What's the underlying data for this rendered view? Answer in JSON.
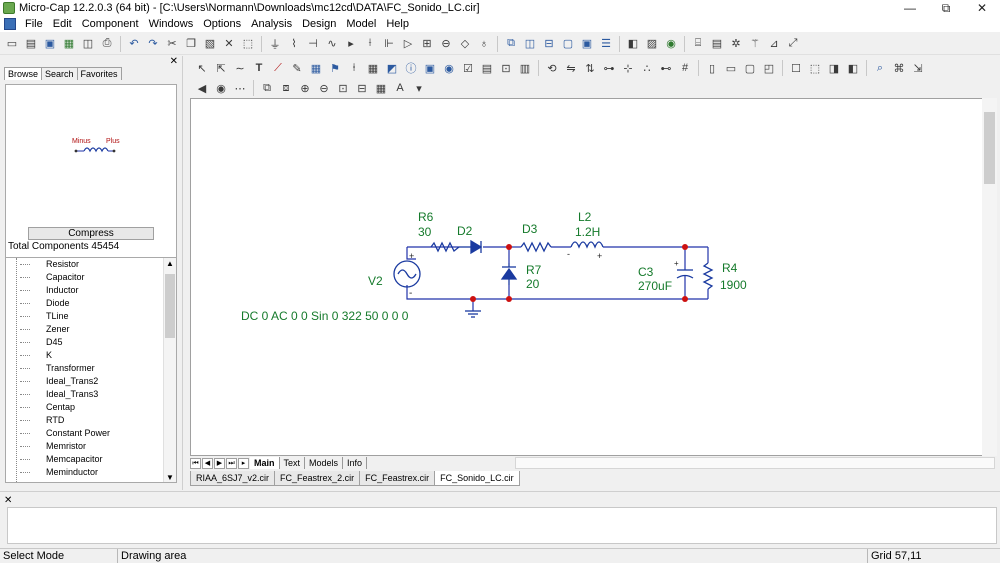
{
  "window": {
    "title": "Micro-Cap 12.2.0.3 (64 bit) - [C:\\Users\\Normann\\Downloads\\mc12cd\\DATA\\FC_Sonido_LC.cir]",
    "minimize": "—",
    "restore": "⧉",
    "close": "✕"
  },
  "menu": [
    "File",
    "Edit",
    "Component",
    "Windows",
    "Options",
    "Analysis",
    "Design",
    "Model",
    "Help"
  ],
  "left_panel": {
    "tabs": [
      "Browse",
      "Search",
      "Favorites"
    ],
    "preview": {
      "label_minus": "Minus",
      "label_plus": "Plus"
    },
    "compress_label": "Compress",
    "total_components": "Total Components 45454",
    "components": [
      "Resistor",
      "Capacitor",
      "Inductor",
      "Diode",
      "TLine",
      "Zener",
      "D45",
      "K",
      "Transformer",
      "Ideal_Trans2",
      "Ideal_Trans3",
      "Centap",
      "RTD",
      "Constant Power",
      "Memristor",
      "Memcapacitor",
      "Meminductor"
    ]
  },
  "schematic": {
    "source_name": "V2",
    "source_spec": "DC 0 AC 0 0 Sin 0 322 50 0 0 0",
    "r6_name": "R6",
    "r6_value": "30",
    "d2_name": "D2",
    "d3_name": "D3",
    "l2_name": "L2",
    "l2_value": "1.2H",
    "r7_name": "R7",
    "r7_value": "20",
    "c3_name": "C3",
    "c3_value": "270uF",
    "r4_name": "R4",
    "r4_value": "1900",
    "plus": "+",
    "minus": "-",
    "wire_color": "#2233aa",
    "label_color": "#157a2b",
    "node_color": "#cc1111",
    "component_color": "#1a3aa0"
  },
  "page_tabs": [
    "Main",
    "Text",
    "Models",
    "Info"
  ],
  "file_tabs": [
    "RIAA_6SJ7_v2.cir",
    "FC_Feastrex_2.cir",
    "FC_Feastrex.cir",
    "FC_Sonido_LC.cir"
  ],
  "status": {
    "mode": "Select Mode",
    "area": "Drawing area",
    "grid": "Grid 57,11"
  }
}
